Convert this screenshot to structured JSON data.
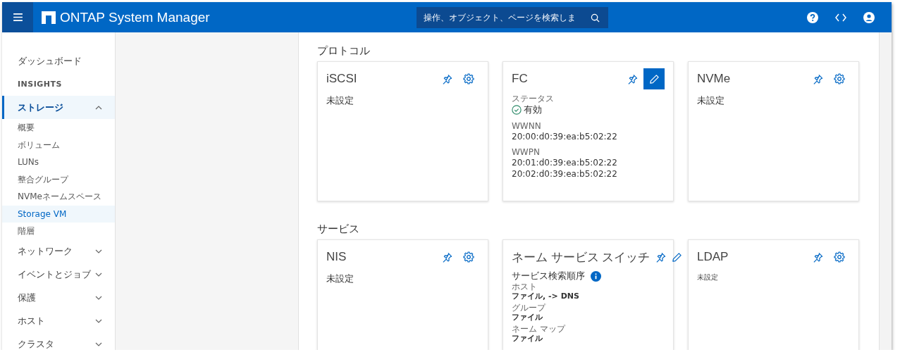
{
  "header": {
    "title": "ONTAP System Manager",
    "search": {
      "placeholder": "操作、オブジェクト、ページを検索しま"
    }
  },
  "sidebar": {
    "items": [
      {
        "label": "ダッシュボード",
        "kind": "link",
        "selected": false
      },
      {
        "label": "INSIGHTS",
        "kind": "strong-link",
        "selected": false
      },
      {
        "label": "ストレージ",
        "kind": "group",
        "selected": true,
        "expanded": true,
        "children": [
          {
            "label": "概要",
            "selected": false
          },
          {
            "label": "ボリューム",
            "selected": false
          },
          {
            "label": "LUNs",
            "selected": false
          },
          {
            "label": "整合グループ",
            "selected": false
          },
          {
            "label": "NVMeネームスペース",
            "selected": false
          },
          {
            "label": "Storage VM",
            "selected": true
          },
          {
            "label": "階層",
            "selected": false
          }
        ]
      },
      {
        "label": "ネットワーク",
        "kind": "group",
        "selected": false,
        "expanded": false
      },
      {
        "label": "イベントとジョブ",
        "kind": "group",
        "selected": false,
        "expanded": false
      },
      {
        "label": "保護",
        "kind": "group",
        "selected": false,
        "expanded": false
      },
      {
        "label": "ホスト",
        "kind": "group",
        "selected": false,
        "expanded": false
      },
      {
        "label": "クラスタ",
        "kind": "group",
        "selected": false,
        "expanded": false
      }
    ]
  },
  "sections": [
    {
      "title": "プロトコル",
      "cards": [
        {
          "title": "iSCSI",
          "editable": false,
          "highlighted": false,
          "body": [
            {
              "kind": "text",
              "text": "未設定"
            }
          ]
        },
        {
          "title": "FC",
          "editable": true,
          "highlighted": true,
          "body": [
            {
              "kind": "status",
              "label": "ステータス",
              "value": "有効"
            },
            {
              "kind": "field",
              "label": "WWNN",
              "values": [
                "20:00:d0:39:ea:b5:02:22"
              ]
            },
            {
              "kind": "field",
              "label": "WWPN",
              "values": [
                "20:01:d0:39:ea:b5:02:22",
                "20:02:d0:39:ea:b5:02:22"
              ]
            }
          ]
        },
        {
          "title": "NVMe",
          "editable": false,
          "highlighted": false,
          "body": [
            {
              "kind": "text",
              "text": "未設定"
            }
          ]
        }
      ]
    },
    {
      "title": "サービス",
      "cards": [
        {
          "title": "NIS",
          "editable": false,
          "highlighted": false,
          "body": [
            {
              "kind": "text",
              "text": "未設定"
            }
          ]
        },
        {
          "title": "ネーム サービス スイッチ",
          "editable": true,
          "highlighted": false,
          "body": [
            {
              "kind": "heading",
              "text": "サービス検索順序"
            },
            {
              "kind": "bold-field",
              "label": "ホスト",
              "values": [
                "**ファイル,** -> DNS"
              ]
            },
            {
              "kind": "bold-field",
              "label": "グループ",
              "values": [
                "ファイル"
              ]
            },
            {
              "kind": "bold-field",
              "label": "ネーム マップ",
              "values": [
                "ファイル"
              ]
            }
          ]
        },
        {
          "title": "LDAP",
          "editable": false,
          "highlighted": false,
          "body": [
            {
              "kind": "note",
              "text": "未設定"
            }
          ]
        }
      ]
    }
  ]
}
